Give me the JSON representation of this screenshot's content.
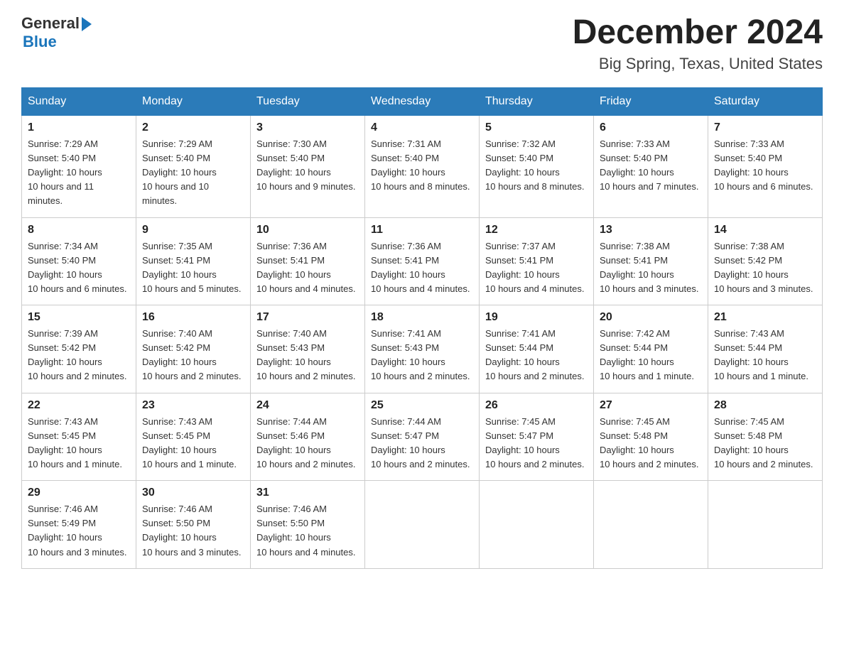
{
  "header": {
    "logo_general": "General",
    "logo_blue": "Blue",
    "month_year": "December 2024",
    "location": "Big Spring, Texas, United States"
  },
  "weekdays": [
    "Sunday",
    "Monday",
    "Tuesday",
    "Wednesday",
    "Thursday",
    "Friday",
    "Saturday"
  ],
  "weeks": [
    [
      {
        "day": "1",
        "sunrise": "7:29 AM",
        "sunset": "5:40 PM",
        "daylight": "10 hours and 11 minutes."
      },
      {
        "day": "2",
        "sunrise": "7:29 AM",
        "sunset": "5:40 PM",
        "daylight": "10 hours and 10 minutes."
      },
      {
        "day": "3",
        "sunrise": "7:30 AM",
        "sunset": "5:40 PM",
        "daylight": "10 hours and 9 minutes."
      },
      {
        "day": "4",
        "sunrise": "7:31 AM",
        "sunset": "5:40 PM",
        "daylight": "10 hours and 8 minutes."
      },
      {
        "day": "5",
        "sunrise": "7:32 AM",
        "sunset": "5:40 PM",
        "daylight": "10 hours and 8 minutes."
      },
      {
        "day": "6",
        "sunrise": "7:33 AM",
        "sunset": "5:40 PM",
        "daylight": "10 hours and 7 minutes."
      },
      {
        "day": "7",
        "sunrise": "7:33 AM",
        "sunset": "5:40 PM",
        "daylight": "10 hours and 6 minutes."
      }
    ],
    [
      {
        "day": "8",
        "sunrise": "7:34 AM",
        "sunset": "5:40 PM",
        "daylight": "10 hours and 6 minutes."
      },
      {
        "day": "9",
        "sunrise": "7:35 AM",
        "sunset": "5:41 PM",
        "daylight": "10 hours and 5 minutes."
      },
      {
        "day": "10",
        "sunrise": "7:36 AM",
        "sunset": "5:41 PM",
        "daylight": "10 hours and 4 minutes."
      },
      {
        "day": "11",
        "sunrise": "7:36 AM",
        "sunset": "5:41 PM",
        "daylight": "10 hours and 4 minutes."
      },
      {
        "day": "12",
        "sunrise": "7:37 AM",
        "sunset": "5:41 PM",
        "daylight": "10 hours and 4 minutes."
      },
      {
        "day": "13",
        "sunrise": "7:38 AM",
        "sunset": "5:41 PM",
        "daylight": "10 hours and 3 minutes."
      },
      {
        "day": "14",
        "sunrise": "7:38 AM",
        "sunset": "5:42 PM",
        "daylight": "10 hours and 3 minutes."
      }
    ],
    [
      {
        "day": "15",
        "sunrise": "7:39 AM",
        "sunset": "5:42 PM",
        "daylight": "10 hours and 2 minutes."
      },
      {
        "day": "16",
        "sunrise": "7:40 AM",
        "sunset": "5:42 PM",
        "daylight": "10 hours and 2 minutes."
      },
      {
        "day": "17",
        "sunrise": "7:40 AM",
        "sunset": "5:43 PM",
        "daylight": "10 hours and 2 minutes."
      },
      {
        "day": "18",
        "sunrise": "7:41 AM",
        "sunset": "5:43 PM",
        "daylight": "10 hours and 2 minutes."
      },
      {
        "day": "19",
        "sunrise": "7:41 AM",
        "sunset": "5:44 PM",
        "daylight": "10 hours and 2 minutes."
      },
      {
        "day": "20",
        "sunrise": "7:42 AM",
        "sunset": "5:44 PM",
        "daylight": "10 hours and 1 minute."
      },
      {
        "day": "21",
        "sunrise": "7:43 AM",
        "sunset": "5:44 PM",
        "daylight": "10 hours and 1 minute."
      }
    ],
    [
      {
        "day": "22",
        "sunrise": "7:43 AM",
        "sunset": "5:45 PM",
        "daylight": "10 hours and 1 minute."
      },
      {
        "day": "23",
        "sunrise": "7:43 AM",
        "sunset": "5:45 PM",
        "daylight": "10 hours and 1 minute."
      },
      {
        "day": "24",
        "sunrise": "7:44 AM",
        "sunset": "5:46 PM",
        "daylight": "10 hours and 2 minutes."
      },
      {
        "day": "25",
        "sunrise": "7:44 AM",
        "sunset": "5:47 PM",
        "daylight": "10 hours and 2 minutes."
      },
      {
        "day": "26",
        "sunrise": "7:45 AM",
        "sunset": "5:47 PM",
        "daylight": "10 hours and 2 minutes."
      },
      {
        "day": "27",
        "sunrise": "7:45 AM",
        "sunset": "5:48 PM",
        "daylight": "10 hours and 2 minutes."
      },
      {
        "day": "28",
        "sunrise": "7:45 AM",
        "sunset": "5:48 PM",
        "daylight": "10 hours and 2 minutes."
      }
    ],
    [
      {
        "day": "29",
        "sunrise": "7:46 AM",
        "sunset": "5:49 PM",
        "daylight": "10 hours and 3 minutes."
      },
      {
        "day": "30",
        "sunrise": "7:46 AM",
        "sunset": "5:50 PM",
        "daylight": "10 hours and 3 minutes."
      },
      {
        "day": "31",
        "sunrise": "7:46 AM",
        "sunset": "5:50 PM",
        "daylight": "10 hours and 4 minutes."
      },
      null,
      null,
      null,
      null
    ]
  ],
  "labels": {
    "sunrise": "Sunrise:",
    "sunset": "Sunset:",
    "daylight": "Daylight:"
  }
}
